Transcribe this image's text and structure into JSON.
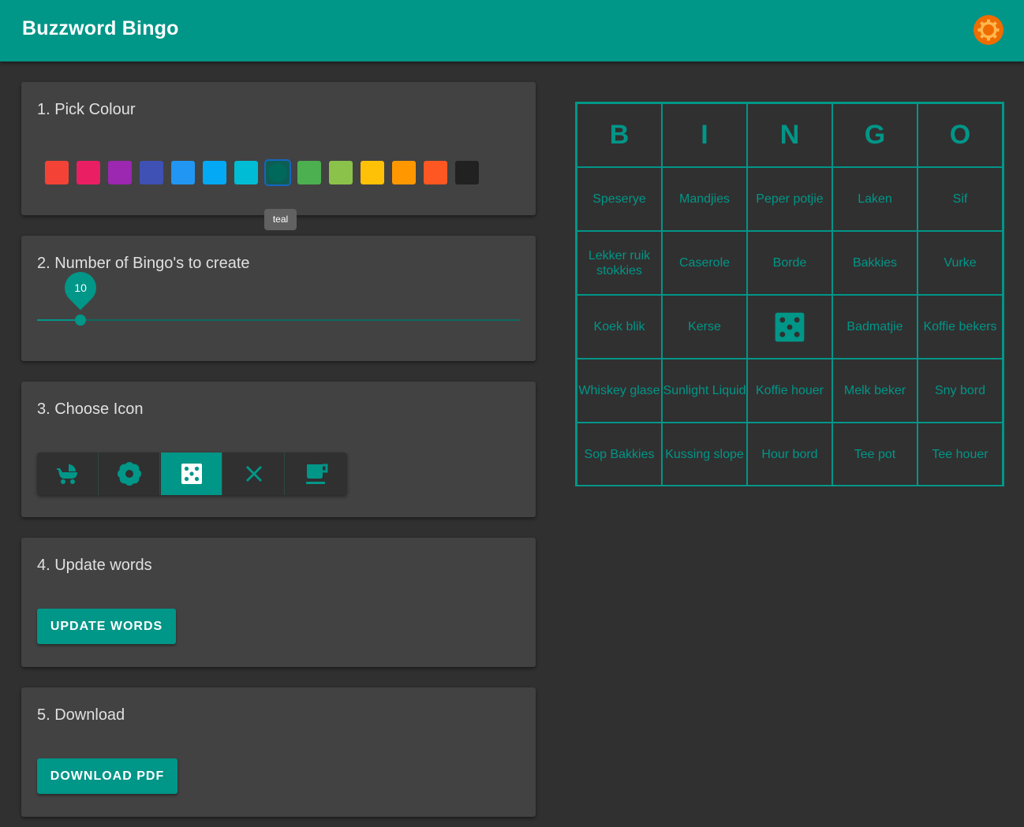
{
  "app": {
    "title": "Buzzword Bingo",
    "accent": "#009688",
    "theme_icon": "sun-icon"
  },
  "step1": {
    "title": "1. Pick Colour",
    "swatches": [
      {
        "name": "red",
        "color": "#f44336"
      },
      {
        "name": "pink",
        "color": "#e91e63"
      },
      {
        "name": "purple",
        "color": "#9c27b0"
      },
      {
        "name": "indigo",
        "color": "#3f51b5"
      },
      {
        "name": "blue",
        "color": "#2196f3"
      },
      {
        "name": "light-blue",
        "color": "#03a9f4"
      },
      {
        "name": "cyan",
        "color": "#00bcd4"
      },
      {
        "name": "teal",
        "color": "#009688",
        "selected": true
      },
      {
        "name": "green",
        "color": "#4caf50"
      },
      {
        "name": "light-green",
        "color": "#8bc34a"
      },
      {
        "name": "amber",
        "color": "#ffc107"
      },
      {
        "name": "orange",
        "color": "#ff9800"
      },
      {
        "name": "deep-orange",
        "color": "#ff5722"
      },
      {
        "name": "black",
        "color": "#212121"
      }
    ],
    "tooltip": "teal"
  },
  "step2": {
    "title": "2. Number of Bingo's to create",
    "value": "10",
    "fraction": 0.09
  },
  "step3": {
    "title": "3. Choose Icon",
    "icons": [
      "stroller-icon",
      "flower-icon",
      "dice-icon",
      "close-icon",
      "cup-icon"
    ],
    "selected_index": 2
  },
  "step4": {
    "title": "4. Update words",
    "button": "UPDATE WORDS"
  },
  "step5": {
    "title": "5. Download",
    "button": "DOWNLOAD PDF"
  },
  "bingo": {
    "header": [
      "B",
      "I",
      "N",
      "G",
      "O"
    ],
    "rows": [
      [
        "Speserye",
        "Mandjies",
        "Peper potjie",
        "Laken",
        "Sif"
      ],
      [
        "Lekker ruik stokkies",
        "Caserole",
        "Borde",
        "Bakkies",
        "Vurke"
      ],
      [
        "Koek blik",
        "Kerse",
        "",
        "Badmatjie",
        "Koffie bekers"
      ],
      [
        "Whiskey glase",
        "Sunlight Liquid",
        "Koffie houer",
        "Melk beker",
        "Sny bord"
      ],
      [
        "Sop Bakkies",
        "Kussing slope",
        "Hour bord",
        "Tee pot",
        "Tee houer"
      ]
    ],
    "center_icon": "dice-icon"
  }
}
